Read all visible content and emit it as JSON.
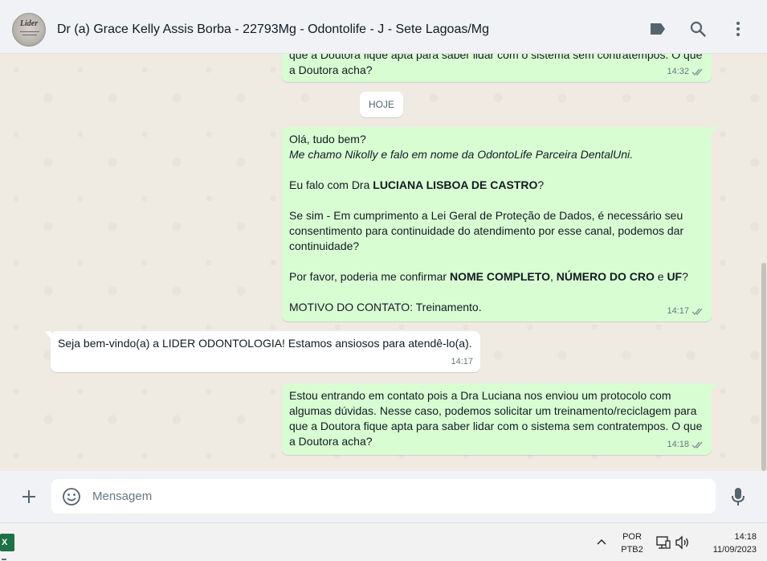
{
  "header": {
    "title": "Dr (a) Grace Kelly Assis Borba - 22793Mg - Odontolife - J - Sete Lagoas/Mg",
    "avatar_text": "Lider",
    "icons": [
      "label-icon",
      "search-icon",
      "menu-icon"
    ]
  },
  "messages": {
    "m0": {
      "text": "que a Doutora fique apta para saber lidar com o sistema sem contratempos. O que\na Doutora acha?",
      "time": "14:32"
    },
    "date_chip": "HOJE",
    "m1": {
      "line1": "Olá, tudo bem?",
      "line2": "Me chamo Nikolly e falo em nome da OdontoLife Parceira DentalUni.",
      "line3_pre": "Eu falo com Dra ",
      "line3_bold": "LUCIANA LISBOA DE CASTRO",
      "line3_post": "?",
      "para2": "Se sim - Em cumprimento a Lei Geral de Proteção de Dados, é necessário seu\nconsentimento para continuidade do atendimento por esse canal, podemos dar\ncontinuidade?",
      "para3_pre": "Por favor, poderia me confirmar ",
      "para3_b1": "NOME COMPLETO",
      "para3_sep1": ", ",
      "para3_b2": "NÚMERO DO CRO",
      "para3_sep2": " e ",
      "para3_b3": "UF",
      "para3_post": "?",
      "para4": "MOTIVO DO CONTATO: Treinamento.",
      "time": "14:17"
    },
    "m2": {
      "text": "Seja bem-vindo(a) a LIDER ODONTOLOGIA! Estamos ansiosos para atendê-lo(a).",
      "time": "14:17"
    },
    "m3": {
      "text": "Estou entrando em contato pois a Dra Luciana nos enviou um protocolo com\nalgumas dúvidas. Nesse caso, podemos solicitar um treinamento/reciclagem para\nque a Doutora fique apta para saber lidar com o sistema sem contratempos. O que\na Doutora acha?",
      "time": "14:18"
    }
  },
  "composer": {
    "placeholder": "Mensagem"
  },
  "taskbar": {
    "excel_label": "X",
    "lang_line1": "POR",
    "lang_line2": "PTB2",
    "time": "14:18",
    "date": "11/09/2023"
  },
  "colors": {
    "outgoing_bubble": "#d9fdd3",
    "incoming_bubble": "#ffffff",
    "chat_background": "#efeae2",
    "read_ticks": "#8696a0"
  }
}
